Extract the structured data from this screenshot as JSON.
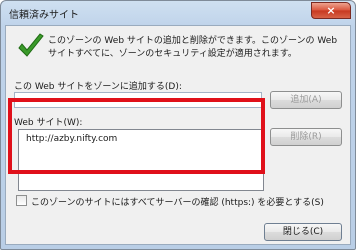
{
  "window": {
    "title": "信頼済みサイト",
    "close_glyph": "×"
  },
  "icon": "green-checkmark-icon",
  "description": "このゾーンの Web サイトの追加と削除ができます。このゾーンの Web サイトすべてに、ゾーンのセキュリティ設定が適用されます。",
  "add_section": {
    "label": "この Web サイトをゾーンに追加する(D):",
    "input_value": "",
    "add_button": "追加(A)"
  },
  "sites_section": {
    "label": "Web サイト(W):",
    "items": [
      "http://azby.nifty.com"
    ],
    "remove_button": "削除(R)"
  },
  "https_checkbox": {
    "label": "このゾーンのサイトにはすべてサーバーの確認 (https:) を必要とする(S)",
    "checked": false
  },
  "close_button": "閉じる(C)",
  "colors": {
    "highlight_border": "#e0101a",
    "check_green": "#3a9a2a"
  }
}
